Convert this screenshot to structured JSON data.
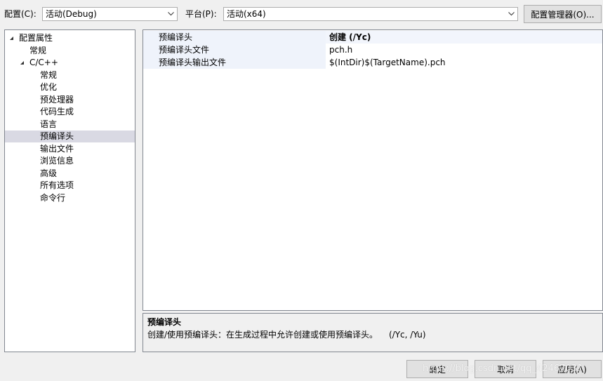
{
  "toolbar": {
    "config_label": "配置(C):",
    "config_value": "活动(Debug)",
    "platform_label": "平台(P):",
    "platform_value": "活动(x64)",
    "config_manager_button": "配置管理器(O)..."
  },
  "tree": {
    "items": [
      {
        "label": "配置属性",
        "expanded": true
      },
      {
        "label": "常规"
      },
      {
        "label": "C/C++",
        "expanded": true
      },
      {
        "label": "常规"
      },
      {
        "label": "优化"
      },
      {
        "label": "预处理器"
      },
      {
        "label": "代码生成"
      },
      {
        "label": "语言"
      },
      {
        "label": "预编译头",
        "selected": true
      },
      {
        "label": "输出文件"
      },
      {
        "label": "浏览信息"
      },
      {
        "label": "高级"
      },
      {
        "label": "所有选项"
      },
      {
        "label": "命令行"
      }
    ]
  },
  "properties": {
    "rows": [
      {
        "name": "预编译头",
        "value": "创建 (/Yc)"
      },
      {
        "name": "预编译头文件",
        "value": "pch.h"
      },
      {
        "name": "预编译头输出文件",
        "value": "$(IntDir)$(TargetName).pch"
      }
    ]
  },
  "description": {
    "title": "预编译头",
    "text": "创建/使用预编译头：在生成过程中允许创建或使用预编译头。",
    "switches": "(/Yc, /Yu)"
  },
  "footer": {
    "ok": "确定",
    "cancel": "取消",
    "apply": "应用(A)"
  },
  "watermark": "https://blog.csdn.net/qq_42467031",
  "colors": {
    "selected_row": "#d9d9e3",
    "property_name_bg": "#eff3fb",
    "panel_border": "#828790"
  }
}
